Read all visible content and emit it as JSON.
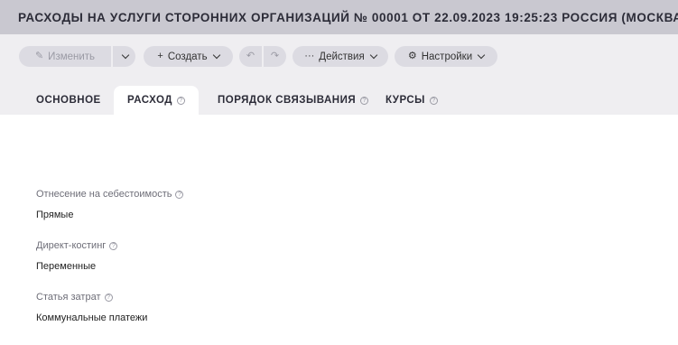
{
  "window": {
    "title": "РАСХОДЫ НА УСЛУГИ СТОРОННИХ ОРГАНИЗАЦИЙ № 00001 ОТ 22.09.2023 19:25:23 РОССИЯ (МОСКВА)"
  },
  "toolbar": {
    "edit_label": "Изменить",
    "create_label": "Создать",
    "actions_label": "Действия",
    "settings_label": "Настройки",
    "icons": {
      "edit": "pencil-icon",
      "create": "plus-icon",
      "undo": "undo-icon",
      "redo": "redo-icon",
      "actions": "ellipsis-icon",
      "settings": "gear-icon",
      "dropdown": "chevron-down-icon"
    }
  },
  "tabs": [
    {
      "label": "ОСНОВНОЕ",
      "active": false,
      "help": false
    },
    {
      "label": "РАСХОД",
      "active": true,
      "help": true
    },
    {
      "label": "ПОРЯДОК СВЯЗЫВАНИЯ",
      "active": false,
      "help": true
    },
    {
      "label": "КУРСЫ",
      "active": false,
      "help": true
    }
  ],
  "fields": [
    {
      "label": "Отнесение на себестоимость",
      "value": "Прямые"
    },
    {
      "label": "Директ-костинг",
      "value": "Переменные"
    },
    {
      "label": "Статья затрат",
      "value": "Коммунальные платежи"
    }
  ],
  "colors": {
    "title_bar": "#c9c8d0",
    "toolbar_zone": "#efeef1",
    "button": "#dcdbe2",
    "text_dark": "#2c2c38",
    "label_gray": "#6e6e78"
  }
}
